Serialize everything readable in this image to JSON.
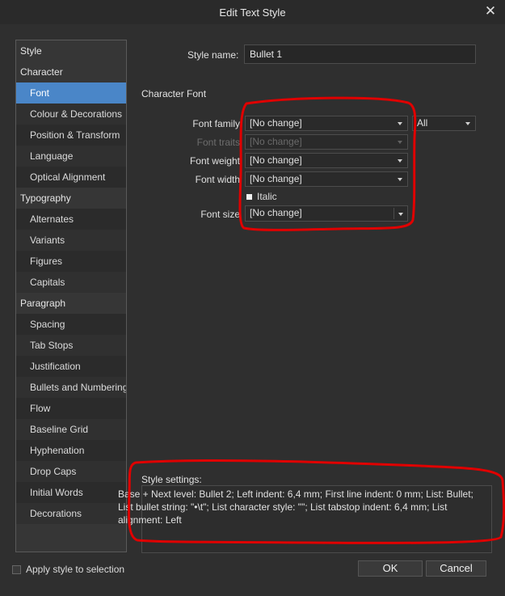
{
  "window": {
    "title": "Edit Text Style"
  },
  "sidebar": {
    "items": [
      {
        "label": "Style",
        "kind": "group"
      },
      {
        "label": "Character",
        "kind": "group"
      },
      {
        "label": "Font",
        "kind": "sub",
        "selected": true
      },
      {
        "label": "Colour & Decorations",
        "kind": "sub"
      },
      {
        "label": "Position & Transform",
        "kind": "sub"
      },
      {
        "label": "Language",
        "kind": "sub"
      },
      {
        "label": "Optical Alignment",
        "kind": "sub"
      },
      {
        "label": "Typography",
        "kind": "group"
      },
      {
        "label": "Alternates",
        "kind": "sub"
      },
      {
        "label": "Variants",
        "kind": "sub"
      },
      {
        "label": "Figures",
        "kind": "sub"
      },
      {
        "label": "Capitals",
        "kind": "sub"
      },
      {
        "label": "Paragraph",
        "kind": "group"
      },
      {
        "label": "Spacing",
        "kind": "sub"
      },
      {
        "label": "Tab Stops",
        "kind": "sub"
      },
      {
        "label": "Justification",
        "kind": "sub"
      },
      {
        "label": "Bullets and Numbering",
        "kind": "sub"
      },
      {
        "label": "Flow",
        "kind": "sub"
      },
      {
        "label": "Baseline Grid",
        "kind": "sub"
      },
      {
        "label": "Hyphenation",
        "kind": "sub"
      },
      {
        "label": "Drop Caps",
        "kind": "sub"
      },
      {
        "label": "Initial Words",
        "kind": "sub"
      },
      {
        "label": "Decorations",
        "kind": "sub"
      }
    ]
  },
  "style_name": {
    "label": "Style name:",
    "value": "Bullet 1"
  },
  "character_font": {
    "heading": "Character Font",
    "font_family": {
      "label": "Font family",
      "value": "[No change]",
      "filter": "All"
    },
    "font_traits": {
      "label": "Font traits",
      "value": "[No change]"
    },
    "font_weight": {
      "label": "Font weight",
      "value": "[No change]"
    },
    "font_width": {
      "label": "Font width",
      "value": "[No change]"
    },
    "italic": {
      "label": "Italic"
    },
    "font_size": {
      "label": "Font size",
      "value": "[No change]"
    }
  },
  "style_settings": {
    "label": "Style settings:",
    "line1": "Base + Next level: Bullet 2; Left indent: 6,4 mm; First line indent: 0 mm; List: Bullet;",
    "line2": "List bullet string: \"•\\t\"; List character style: \"\"; List tabstop indent: 6,4 mm; List",
    "line3": "alignment: Left"
  },
  "footer": {
    "apply_label": "Apply style to selection",
    "ok_label": "OK",
    "cancel_label": "Cancel"
  },
  "colors": {
    "selection": "#4a86c8",
    "annotation": "#e00000",
    "background": "#2f2f2f"
  }
}
